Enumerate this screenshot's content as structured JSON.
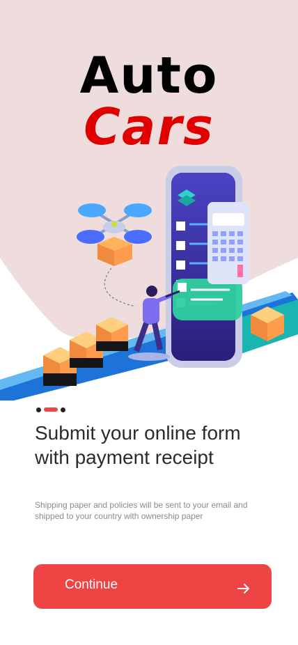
{
  "brand": {
    "line1": "Auto",
    "line2": "Cars"
  },
  "onboarding": {
    "page_index": 2,
    "page_count": 3,
    "title": "Submit your online form with payment receipt",
    "subtitle": "Shipping paper and policies will be sent to your email and shipped to your country with ownership paper"
  },
  "actions": {
    "continue_label": "Continue",
    "continue_icon": "arrow-right-icon"
  },
  "colors": {
    "accent": "#ef4444",
    "hero_bg": "#f0dcdc",
    "brand_red": "#e00000",
    "text_dark": "#2b2b2b"
  }
}
